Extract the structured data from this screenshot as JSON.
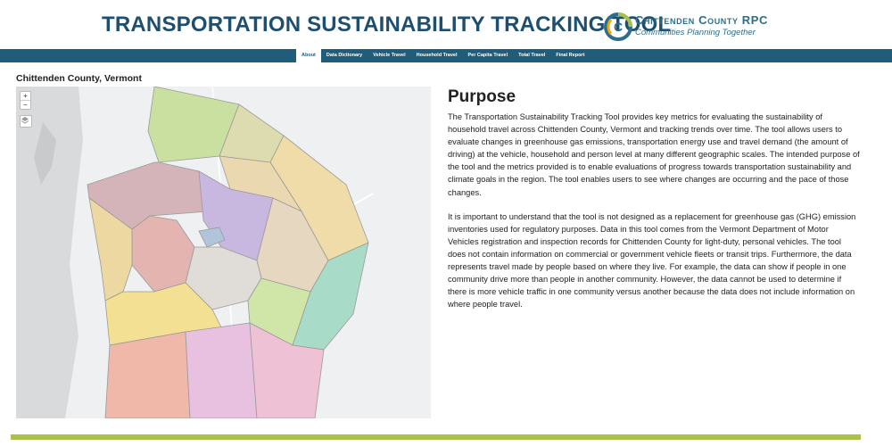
{
  "header": {
    "title": "TRANSPORTATION SUSTAINABILITY TRACKING TOOL",
    "org_name": "Chittenden County RPC",
    "org_tagline": "Communities Planning Together",
    "logo_icon": "ccrpc-logo-icon"
  },
  "nav": {
    "tabs": [
      {
        "label": "About",
        "active": true
      },
      {
        "label": "Data Dictionary",
        "active": false
      },
      {
        "label": "Vehicle Travel",
        "active": false
      },
      {
        "label": "Household Travel",
        "active": false
      },
      {
        "label": "Per Capita Travel",
        "active": false
      },
      {
        "label": "Total Travel",
        "active": false
      },
      {
        "label": "Final Report",
        "active": false
      }
    ]
  },
  "map": {
    "region_title": "Chittenden County, Vermont",
    "zoom_in": "+",
    "zoom_out": "−",
    "layers_icon": "layers-icon"
  },
  "content": {
    "heading": "Purpose",
    "paragraph1": "The Transportation Sustainability Tracking Tool provides key metrics for evaluating the sustainability of household travel across Chittenden County, Vermont and tracking trends over time. The tool allows users to evaluate changes in greenhouse gas emissions, transportation energy use and travel demand (the amount of driving) at the vehicle, household and person level at many different geographic scales. The intended purpose of the tool and the metrics provided is to enable evaluations of progress towards transportation sustainability and climate goals in the region. The tool enables users to see where changes are occurring and the pace of those changes.",
    "paragraph2": "It is important to understand that the tool is not designed as a replacement for greenhouse gas (GHG) emission inventories used for regulatory purposes. Data in this tool comes from the Vermont Department of Motor Vehicles registration and inspection records for Chittenden County for light-duty, personal vehicles. The tool does not contain information on commercial or government vehicle fleets or transit trips. Furthermore, the data represents travel made by people based on where they live. For example, the data can show if people in one community drive more than people in another community. However, the data cannot be used to determine if there is more vehicle traffic in one community versus another because the data does not include information on where people travel."
  },
  "colors": {
    "title": "#1e4f6e",
    "navbar": "#1f5d7a",
    "footer_bar": "#a7c14a"
  }
}
